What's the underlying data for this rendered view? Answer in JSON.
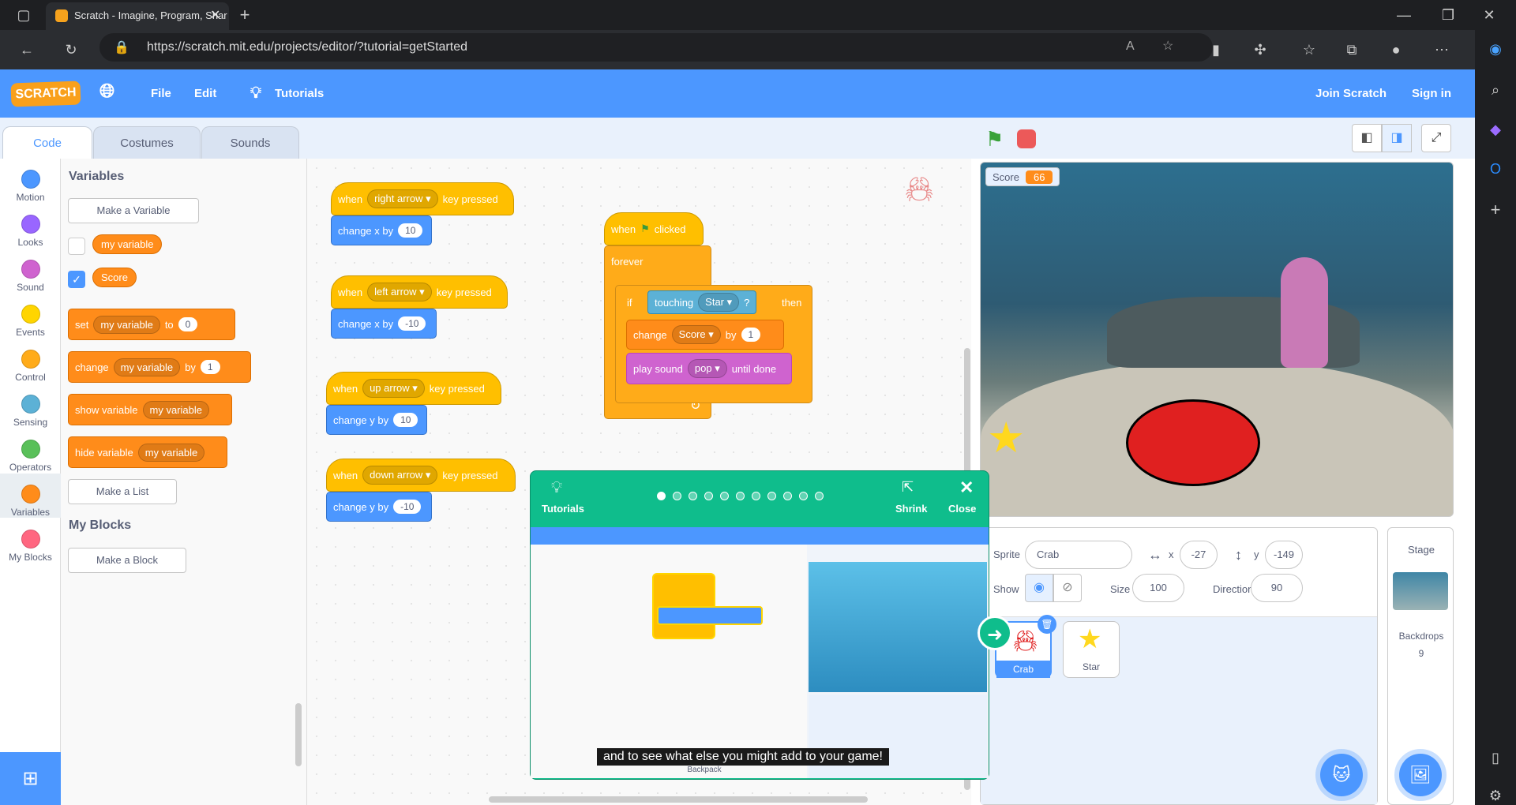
{
  "browser": {
    "tab_title": "Scratch - Imagine, Program, Shar",
    "url": "https://scratch.mit.edu/projects/editor/?tutorial=getStarted"
  },
  "menu": {
    "logo": "SCRATCH",
    "file": "File",
    "edit": "Edit",
    "tutorials": "Tutorials",
    "join": "Join Scratch",
    "signin": "Sign in"
  },
  "tabs": {
    "code": "Code",
    "costumes": "Costumes",
    "sounds": "Sounds"
  },
  "categories": [
    {
      "label": "Motion",
      "color": "#4c97ff"
    },
    {
      "label": "Looks",
      "color": "#9966ff"
    },
    {
      "label": "Sound",
      "color": "#cf63cf"
    },
    {
      "label": "Events",
      "color": "#ffd500"
    },
    {
      "label": "Control",
      "color": "#ffab19"
    },
    {
      "label": "Sensing",
      "color": "#5cb1d6"
    },
    {
      "label": "Operators",
      "color": "#59c059"
    },
    {
      "label": "Variables",
      "color": "#ff8c1a"
    },
    {
      "label": "My Blocks",
      "color": "#ff6680"
    }
  ],
  "palette": {
    "title": "Variables",
    "make_var": "Make a Variable",
    "var1": "my variable",
    "var2": "Score",
    "set": "set",
    "to": "to",
    "set_val": "0",
    "change": "change",
    "by": "by",
    "change_val": "1",
    "show": "show variable",
    "hide": "hide variable",
    "make_list": "Make a List",
    "myblocks": "My Blocks",
    "make_block": "Make a Block"
  },
  "scripts": {
    "when": "when",
    "key_pressed": "key pressed",
    "right": "right arrow",
    "left": "left arrow",
    "up": "up arrow",
    "down": "down arrow",
    "change_x": "change x by",
    "change_y": "change y by",
    "v10": "10",
    "vm10": "-10",
    "clicked": "clicked",
    "forever": "forever",
    "if": "if",
    "touching": "touching",
    "star": "Star",
    "q": "?",
    "then": "then",
    "change": "change",
    "score": "Score",
    "by": "by",
    "one": "1",
    "play": "play sound",
    "pop": "pop",
    "until": "until done"
  },
  "stage": {
    "score_label": "Score",
    "score_value": "66"
  },
  "sprite_info": {
    "sprite_label": "Sprite",
    "sprite_name": "Crab",
    "x_label": "x",
    "x": "-27",
    "y_label": "y",
    "y": "-149",
    "show_label": "Show",
    "size_label": "Size",
    "size": "100",
    "dir_label": "Direction",
    "dir": "90"
  },
  "sprites": [
    {
      "name": "Crab"
    },
    {
      "name": "Star"
    }
  ],
  "stage_pane": {
    "title": "Stage",
    "backdrops": "Backdrops",
    "count": "9"
  },
  "tutorial": {
    "label": "Tutorials",
    "shrink": "Shrink",
    "close": "Close",
    "caption": "and to see what else you might add to your game!",
    "step_total": 11,
    "step_current": 1,
    "backpack": "Backpack"
  }
}
